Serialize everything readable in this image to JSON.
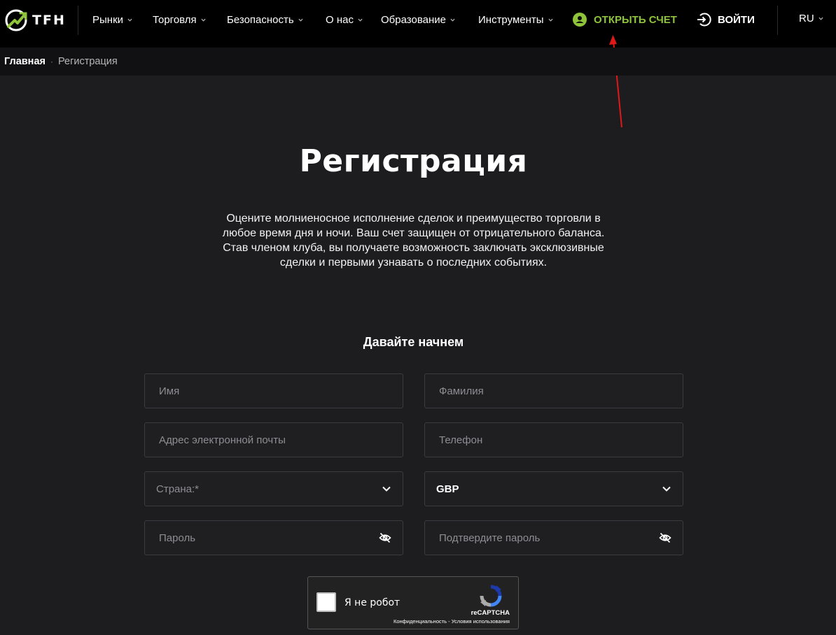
{
  "header": {
    "logo_text": "TFH",
    "nav": [
      {
        "label": "Рынки"
      },
      {
        "label": "Торговля"
      },
      {
        "label": "Безопасность"
      },
      {
        "label": "О нас"
      },
      {
        "label": "Образование"
      },
      {
        "label": "Инструменты"
      }
    ],
    "open_account_label": "ОТКРЫТЬ СЧЕТ",
    "login_label": "ВОЙТИ",
    "language": "RU",
    "accent_color": "#8fc43a"
  },
  "breadcrumb": {
    "home": "Главная",
    "separator": "·",
    "current": "Регистрация"
  },
  "main": {
    "title": "Регистрация",
    "intro": "Оцените молниеносное исполнение сделок и преимущество торговли в любое время дня и ночи. Ваш счет защищен от отрицательного баланса. Став членом клуба, вы получаете возможность заключать эксклюзивные сделки и первыми узнавать о последних событиях.",
    "subtitle": "Давайте начнем"
  },
  "form": {
    "first_name_placeholder": "Имя",
    "last_name_placeholder": "Фамилия",
    "email_placeholder": "Адрес электронной почты",
    "phone_placeholder": "Телефон",
    "country_placeholder": "Страна:*",
    "currency_value": "GBP",
    "password_placeholder": "Пароль",
    "confirm_password_placeholder": "Подтвердите пароль"
  },
  "captcha": {
    "label": "Я не робот",
    "brand": "reCAPTCHA",
    "links": "Конфиденциальность - Условия использования"
  }
}
